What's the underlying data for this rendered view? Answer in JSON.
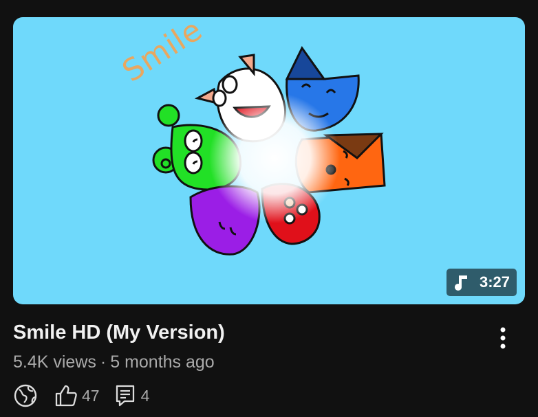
{
  "video": {
    "thumbnail_text": "Smile",
    "duration": "3:27",
    "duration_icon": "music-note-icon",
    "title": "Smile HD (My Version)",
    "views": "5.4K views",
    "separator": "·",
    "age": "5 months ago",
    "visibility_icon": "globe-icon",
    "likes": "47",
    "comments": "4"
  },
  "colors": {
    "background": "#111111",
    "thumbnail_bg": "#6fd9fb",
    "badge_bg": "#2f5c6b",
    "secondary_text": "#aaaaaa"
  }
}
